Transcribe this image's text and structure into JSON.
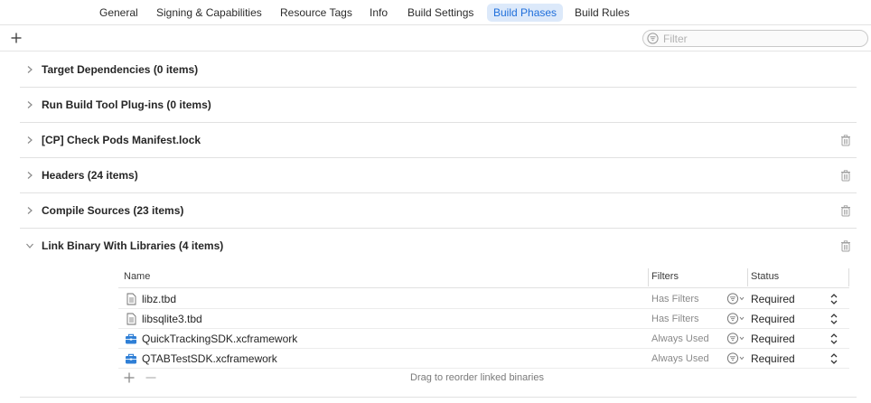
{
  "tabs": [
    {
      "label": "General",
      "active": false
    },
    {
      "label": "Signing & Capabilities",
      "active": false
    },
    {
      "label": "Resource Tags",
      "active": false
    },
    {
      "label": "Info",
      "active": false
    },
    {
      "label": "Build Settings",
      "active": false
    },
    {
      "label": "Build Phases",
      "active": true
    },
    {
      "label": "Build Rules",
      "active": false
    }
  ],
  "toolbar": {
    "add_icon": "plus-icon",
    "filter_placeholder": "Filter",
    "filter_icon": "filter-circle-icon"
  },
  "phases": [
    {
      "title": "Target Dependencies (0 items)",
      "expanded": false,
      "deletable": false
    },
    {
      "title": "Run Build Tool Plug-ins (0 items)",
      "expanded": false,
      "deletable": false
    },
    {
      "title": "[CP] Check Pods Manifest.lock",
      "expanded": false,
      "deletable": true
    },
    {
      "title": "Headers (24 items)",
      "expanded": false,
      "deletable": true
    },
    {
      "title": "Compile Sources (23 items)",
      "expanded": false,
      "deletable": true
    },
    {
      "title": "Link Binary With Libraries (4 items)",
      "expanded": true,
      "deletable": true
    }
  ],
  "link_table": {
    "columns": {
      "name": "Name",
      "filters": "Filters",
      "status": "Status"
    },
    "rows": [
      {
        "name": "libz.tbd",
        "icon": "tbd-file-icon",
        "filters": "Has Filters",
        "status": "Required"
      },
      {
        "name": "libsqlite3.tbd",
        "icon": "tbd-file-icon",
        "filters": "Has Filters",
        "status": "Required"
      },
      {
        "name": "QuickTrackingSDK.xcframework",
        "icon": "framework-toolbox-icon",
        "filters": "Always Used",
        "status": "Required"
      },
      {
        "name": "QTABTestSDK.xcframework",
        "icon": "framework-toolbox-icon",
        "filters": "Always Used",
        "status": "Required"
      }
    ],
    "footer_hint": "Drag to reorder linked binaries"
  },
  "colors": {
    "accent": "#1f6fdb",
    "active_tab_bg": "#dce9fa",
    "framework_icon": "#2f7fd6"
  }
}
